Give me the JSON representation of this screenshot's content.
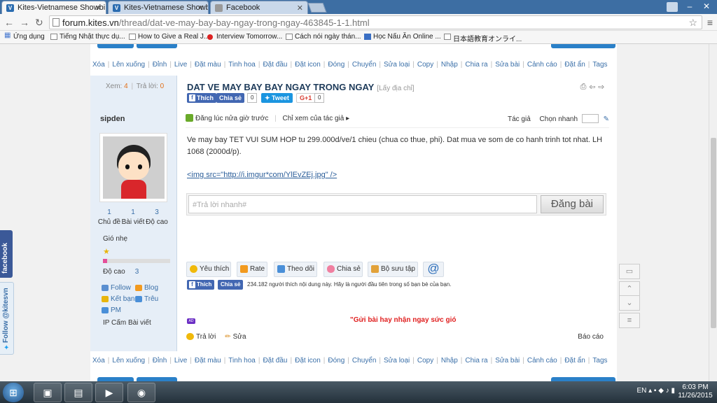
{
  "browser": {
    "tabs": [
      {
        "label": "Kites-Vietnamese Showbi",
        "favicon": "kites-icon"
      },
      {
        "label": "Kites-Vietnamese Showbi",
        "favicon": "kites-icon"
      },
      {
        "label": "Facebook",
        "favicon": "page-icon"
      }
    ],
    "url_host": "forum.kites.vn",
    "url_path": "/thread/dat-ve-may-bay-bay-ngay-trong-ngay-463845-1-1.html",
    "bookmarks": [
      "Ứng dụng",
      "Tiếng Nhật thực dụ...",
      "How to Give a Real J...",
      "Interview Tomorrow...",
      "Cách nói ngày thán...",
      "Học Nấu Ăn Online ...",
      "日本語教育オンライ..."
    ]
  },
  "modbar": [
    "Xóa",
    "Lên xuống",
    "Đỉnh",
    "Live",
    "Đặt màu",
    "Tinh hoa",
    "Đặt đầu",
    "Đặt icon",
    "Đóng",
    "Chuyển",
    "Sửa loại",
    "Copy",
    "Nhập",
    "Chia ra",
    "Sửa bài",
    "Cảnh cáo",
    "Đặt ẩn",
    "Tags"
  ],
  "thread": {
    "views_label": "Xem:",
    "views": "4",
    "replies_label": "Trả lời:",
    "replies": "0",
    "title": "DAT VE MAY BAY BAY NGAY TRONG NGAY",
    "title_link": "[Lấy địa chỉ]"
  },
  "social": {
    "like": "Thích",
    "share": "Chia sẻ",
    "fb_count": "0",
    "tweet": "Tweet",
    "gplus": "G+1",
    "gplus_count": "0"
  },
  "user": {
    "name": "sipden",
    "counts": [
      {
        "num": "1",
        "label": "Chủ đề"
      },
      {
        "num": "1",
        "label": "Bài viết"
      },
      {
        "num": "3",
        "label": "Độ cao"
      }
    ],
    "rank": "Gió nhẹ",
    "level_fraction": 0.06,
    "height_label": "Độ cao",
    "height_value": "3",
    "links": [
      "Follow",
      "Blog",
      "Kết bạn",
      "Trêu",
      "PM"
    ],
    "ip_ban": "IP Cấm Bài viết"
  },
  "meta": {
    "posted": "Đăng lúc nửa giờ trước",
    "author_only": "Chỉ xem của tác giả",
    "author": "Tác giả",
    "jump": "Chọn nhanh"
  },
  "post": {
    "body": "Ve may bay TET VUI SUM HOP tu 299.000d/ve/1 chieu (chua co thue, phi). Dat mua ve som de co hanh trinh tot nhat. LH 1068 (2000d/p).",
    "link": "<img src=\"http://i.imgur*com/YlEvZEj.jpg\" />"
  },
  "quick_reply": {
    "placeholder": "#Trả lời nhanh#",
    "submit": "Đăng bài"
  },
  "actions": [
    "Yêu thích",
    "Rate",
    "Theo dõi",
    "Chia sẻ",
    "Bộ sưu tập",
    "@"
  ],
  "like_bar": {
    "like": "Thích",
    "share": "Chia sẻ",
    "text": "234.182 người thích nội dung này. Hãy là người đầu tiên trong số bạn bè của bạn."
  },
  "promo": {
    "badge": "AD",
    "text": "\"Gửi bài hay nhận ngay sức gió"
  },
  "footer": {
    "reply": "Trả lời",
    "edit": "Sửa",
    "report": "Báo cáo"
  },
  "side_widgets": {
    "facebook": "facebook",
    "twitter": "Follow @kitesvn"
  },
  "taskbar": {
    "lang": "EN",
    "time": "6:03 PM",
    "date": "11/26/2015"
  }
}
